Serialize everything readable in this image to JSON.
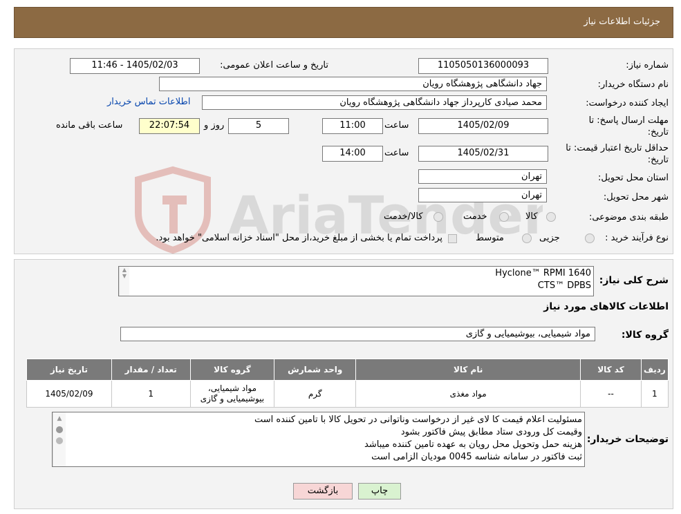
{
  "header": {
    "title": "جزئیات اطلاعات نیاز"
  },
  "fields": {
    "need_number_label": "شماره نیاز:",
    "need_number": "1105050136000093",
    "announce_label": "تاریخ و ساعت اعلان عمومی:",
    "announce_value": "1405/02/03 - 11:46",
    "buyer_org_label": "نام دستگاه خریدار:",
    "buyer_org": "جهاد دانشگاهی پژوهشگاه رویان",
    "requester_label": "ایجاد کننده درخواست:",
    "requester": "محمد صیادی کارپرداز جهاد دانشگاهی پژوهشگاه رویان",
    "contact_link": "اطلاعات تماس خریدار",
    "deadline_label_1": "مهلت ارسال پاسخ: تا",
    "deadline_label_2": "تاریخ:",
    "deadline_date": "1405/02/09",
    "time_label": "ساعت",
    "deadline_time": "11:00",
    "days_value": "5",
    "days_label": "روز و",
    "remaining_time": "22:07:54",
    "remaining_label": "ساعت باقی مانده",
    "validity_label_1": "حداقل تاریخ اعتبار قیمت: تا",
    "validity_label_2": "تاریخ:",
    "validity_date": "1405/02/31",
    "validity_time": "14:00",
    "province_label": "استان محل تحویل:",
    "province": "تهران",
    "city_label": "شهر محل تحویل:",
    "city": "تهران",
    "category_label": "طبقه بندی موضوعی:",
    "category_options": [
      "کالا",
      "خدمت",
      "کالا/خدمت"
    ],
    "purchase_type_label": "نوع فرآیند خرید :",
    "purchase_options": [
      "جزیی",
      "متوسط"
    ],
    "purchase_note": "پرداخت تمام یا بخشی از مبلغ خرید،از محل \"اسناد خزانه اسلامی\" خواهد بود."
  },
  "watermark": {
    "text": "AriaTender.neT"
  },
  "description": {
    "label": "شرح کلی نیاز:",
    "lines": [
      "Hyclone™ RPMI 1640",
      "CTS™ DPBS"
    ]
  },
  "goods_info": {
    "title": "اطلاعات کالاهای مورد نیاز",
    "group_label": "گروه کالا:",
    "group_value": "مواد شیمیایی، بیوشیمیایی و گازی"
  },
  "table": {
    "headers": [
      "ردیف",
      "کد کالا",
      "نام کالا",
      "واحد شمارش",
      "گروه کالا",
      "تعداد / مقدار",
      "تاریخ نیاز"
    ],
    "rows": [
      {
        "row": "1",
        "code": "--",
        "name": "مواد مغذی",
        "unit": "گرم",
        "group_line1": "مواد شیمیایی،",
        "group_line2": "بیوشیمیایی و گازی",
        "qty": "1",
        "date": "1405/02/09"
      }
    ]
  },
  "buyer_notes": {
    "label": "توضیحات خریدار:",
    "lines": [
      "مسئولیت اعلام قیمت کا لای  غیر از درخواست وناتوانی در تحویل کالا با تامین کننده است",
      "وقیمت کل ورودی ستاد مطابق پیش فاکتور بشود",
      "هزینه حمل وتحویل محل رویان به عهده تامین کننده میباشد",
      "ثبت فاکتور در سامانه  شناسه 0045 مودیان الزامی است"
    ]
  },
  "buttons": {
    "print": "چاپ",
    "back": "بازگشت"
  },
  "colors": {
    "header": "#8c6a43",
    "table_header": "#7a7a7a",
    "time_highlight": "#ffffcc",
    "link": "#0645ad",
    "back_button": "#f7d6d6",
    "print_button": "#d9f2d0"
  }
}
